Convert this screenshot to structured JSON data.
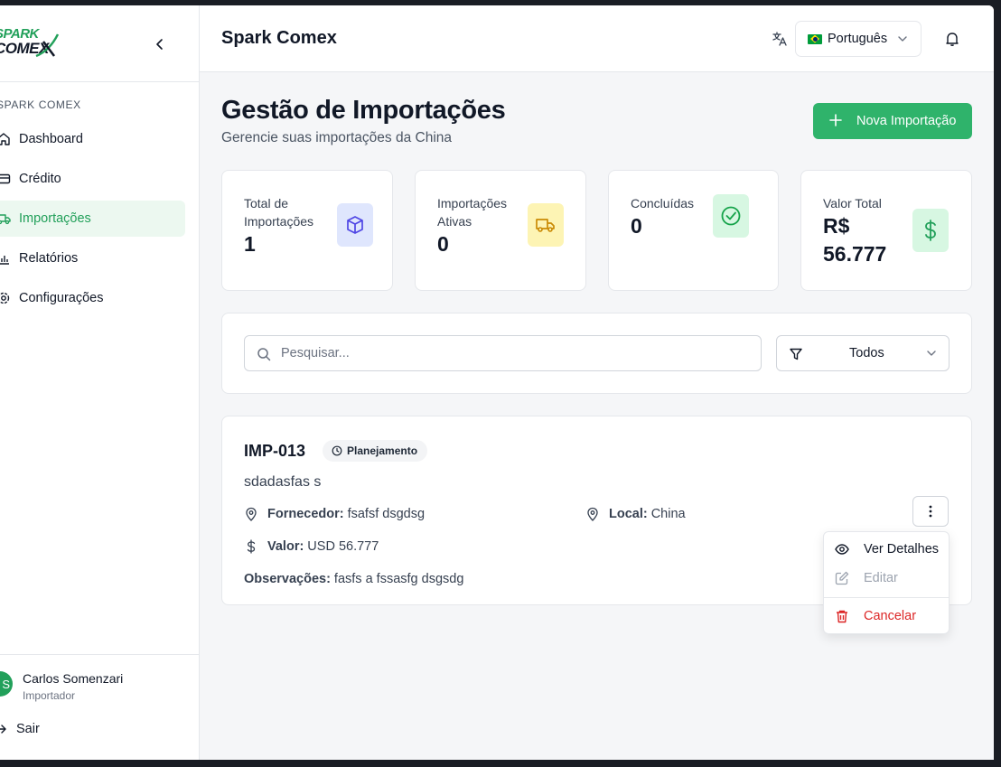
{
  "brand": {
    "logo_top": "SPARK",
    "logo_bottom": "COMEX",
    "accent": "#2fb36b"
  },
  "sidebar": {
    "section_title": "SPARK COMEX",
    "items": [
      {
        "label": "Dashboard",
        "icon": "home-icon",
        "active": false
      },
      {
        "label": "Crédito",
        "icon": "credit-card-icon",
        "active": false
      },
      {
        "label": "Importações",
        "icon": "truck-icon",
        "active": true
      },
      {
        "label": "Relatórios",
        "icon": "bar-chart-icon",
        "active": false
      },
      {
        "label": "Configurações",
        "icon": "gear-icon",
        "active": false
      }
    ],
    "user": {
      "initial": "S",
      "name": "Carlos Somenzari",
      "role": "Importador"
    },
    "logout_label": "Sair"
  },
  "header": {
    "title": "Spark Comex",
    "language": "Português"
  },
  "main": {
    "title": "Gestão de Importações",
    "subtitle": "Gerencie suas importações da China",
    "new_button_label": "Nova Importação",
    "stats": [
      {
        "label": "Total de Importações",
        "value": "1",
        "icon": "box-icon",
        "color": "#4f46e5"
      },
      {
        "label": "Importações Ativas",
        "value": "0",
        "icon": "truck-icon",
        "color": "#ca8a04"
      },
      {
        "label": "Concluídas",
        "value": "0",
        "icon": "check-circle-icon",
        "color": "#16a34a"
      },
      {
        "label": "Valor Total",
        "value": "R$ 56.777",
        "icon": "dollar-icon",
        "color": "#22a05a"
      }
    ],
    "search": {
      "placeholder": "Pesquisar...",
      "filter_value": "Todos"
    },
    "import": {
      "code": "IMP-013",
      "status": "Planejamento",
      "description": "sdadasfas s",
      "supplier_label": "Fornecedor:",
      "supplier": "fsafsf dsgdsg",
      "location_label": "Local:",
      "location": "China",
      "value_label": "Valor:",
      "value": "USD 56.777",
      "notes_label": "Observações:",
      "notes": "fasfs a fssasfg dsgsdg"
    },
    "menu": {
      "view": "Ver Detalhes",
      "edit": "Editar",
      "cancel": "Cancelar",
      "cancel_color": "#dc2626"
    }
  }
}
